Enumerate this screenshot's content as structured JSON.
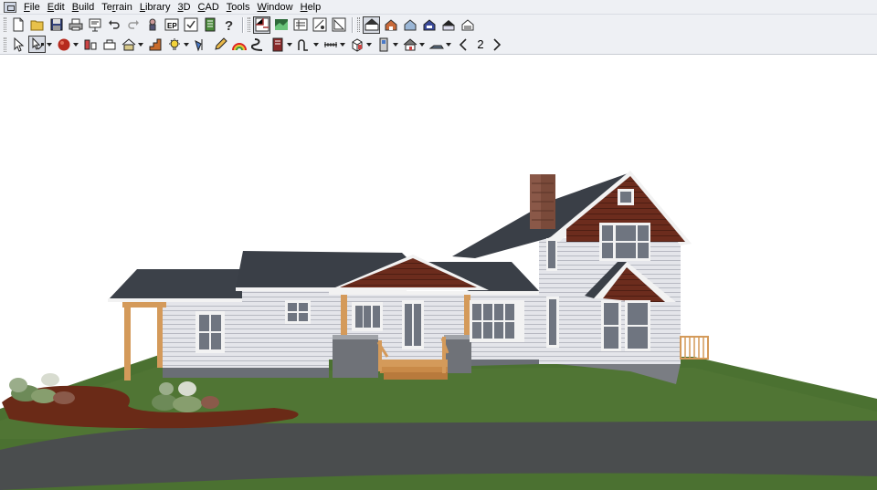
{
  "menu": {
    "items": [
      {
        "pre": "",
        "ul": "F",
        "post": "ile"
      },
      {
        "pre": "",
        "ul": "E",
        "post": "dit"
      },
      {
        "pre": "",
        "ul": "B",
        "post": "uild"
      },
      {
        "pre": "Te",
        "ul": "r",
        "post": "rain"
      },
      {
        "pre": "",
        "ul": "L",
        "post": "ibrary"
      },
      {
        "pre": "",
        "ul": "3",
        "post": "D"
      },
      {
        "pre": "",
        "ul": "C",
        "post": "AD"
      },
      {
        "pre": "",
        "ul": "T",
        "post": "ools"
      },
      {
        "pre": "",
        "ul": "W",
        "post": "indow"
      },
      {
        "pre": "",
        "ul": "H",
        "post": "elp"
      }
    ]
  },
  "toolbar2": {
    "floor_number": "2"
  },
  "colors": {
    "toolbar_bg": "#eef0f4",
    "lawn": "#4a7030",
    "driveway": "#4a4d4e",
    "roof": "#3a3f47",
    "siding": "#e3e4e8",
    "gable": "#6b2e1f",
    "mulch": "#6a2a17"
  }
}
